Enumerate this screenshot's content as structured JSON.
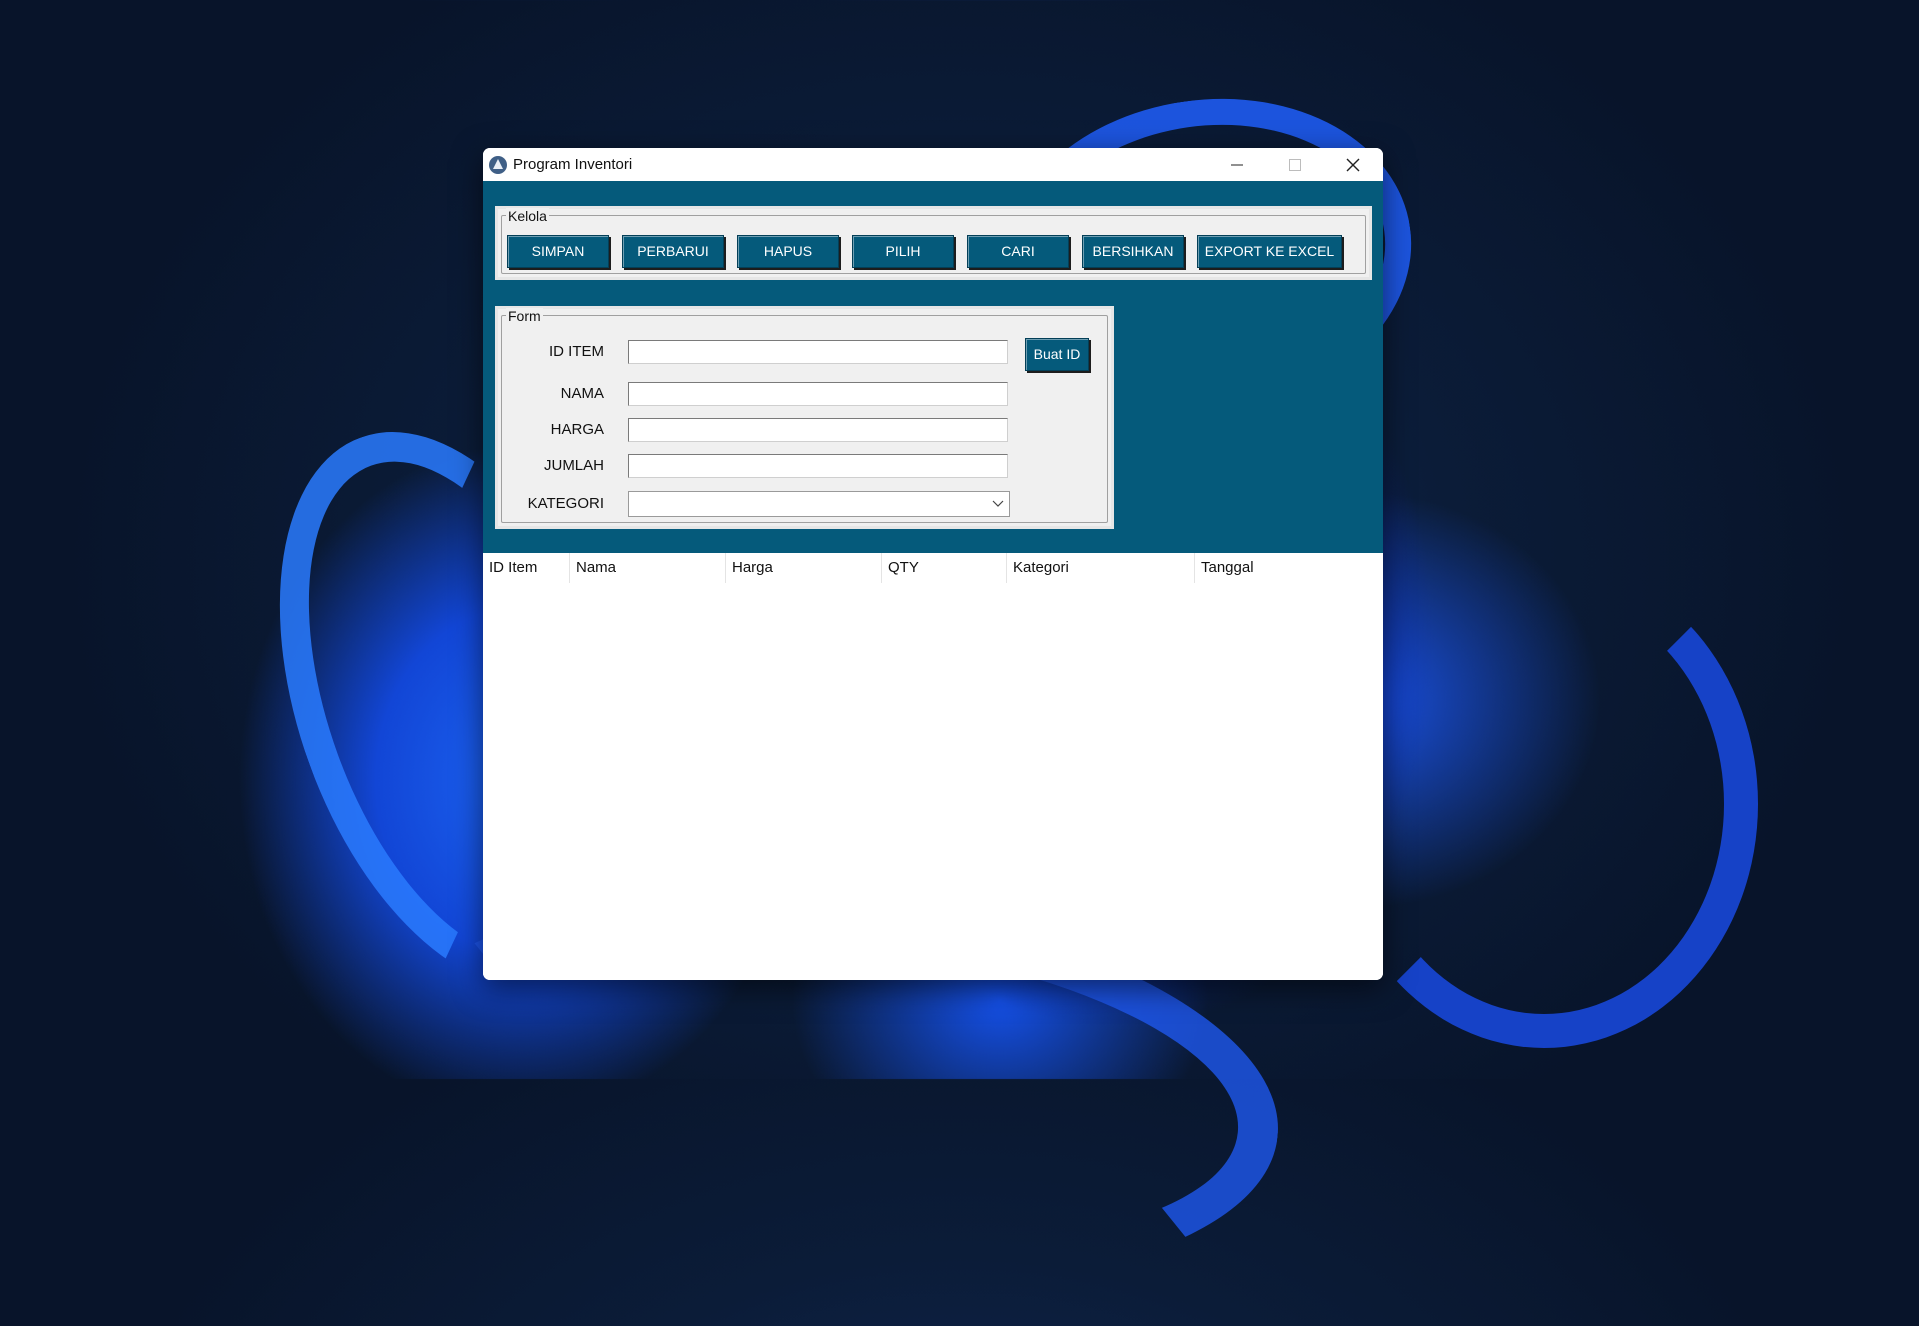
{
  "window": {
    "title": "Program Inventori",
    "minimize_icon": "minimize-icon",
    "maximize_icon": "maximize-icon",
    "close_icon": "close-icon"
  },
  "kelola": {
    "legend": "Kelola",
    "buttons": [
      "SIMPAN",
      "PERBARUI",
      "HAPUS",
      "PILIH",
      "CARI",
      "BERSIHKAN",
      "EXPORT KE EXCEL"
    ]
  },
  "form": {
    "legend": "Form",
    "fields": {
      "id_item": {
        "label": "ID ITEM",
        "value": ""
      },
      "nama": {
        "label": "NAMA",
        "value": ""
      },
      "harga": {
        "label": "HARGA",
        "value": ""
      },
      "jumlah": {
        "label": "JUMLAH",
        "value": ""
      },
      "kategori": {
        "label": "KATEGORI",
        "value": ""
      }
    },
    "generate_id_button": "Buat ID"
  },
  "table": {
    "columns": [
      "ID Item",
      "Nama",
      "Harga",
      "QTY",
      "Kategori",
      "Tanggal"
    ],
    "rows": []
  },
  "colors": {
    "client_bg": "#055a7b",
    "button_bg": "#055a7b",
    "button_text": "#ffffff"
  }
}
